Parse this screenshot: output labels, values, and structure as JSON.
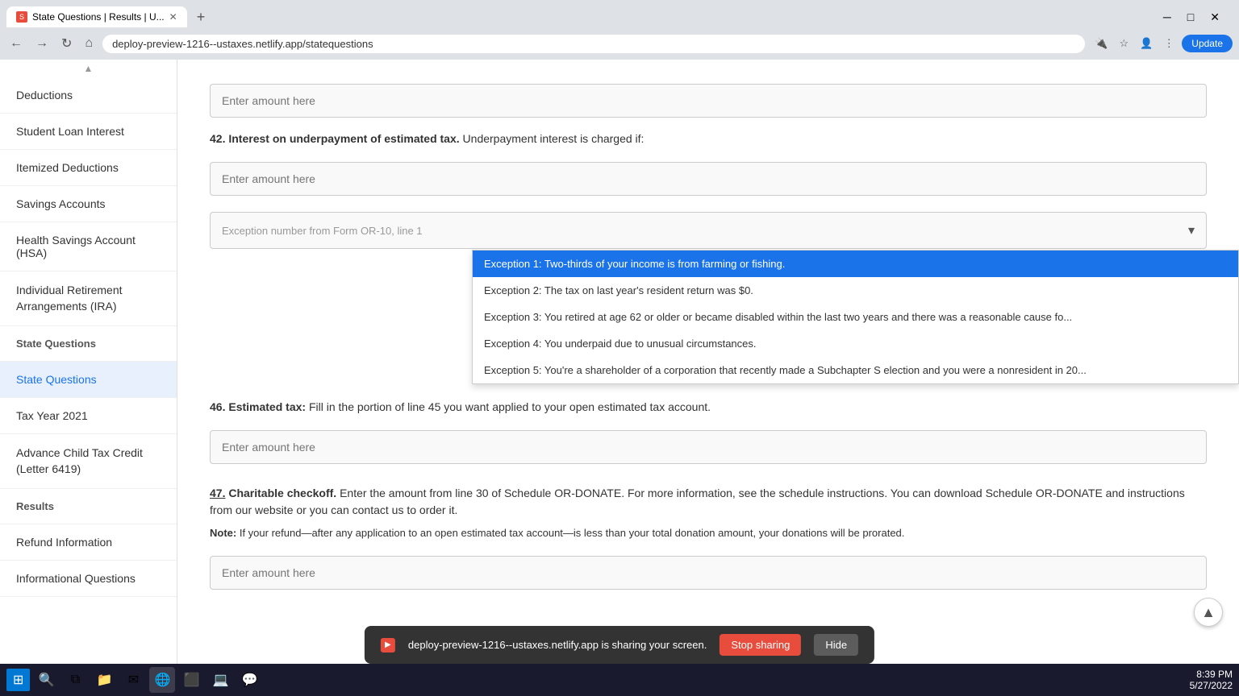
{
  "browser": {
    "tab_title": "State Questions | Results | U...",
    "tab_favicon": "S",
    "address": "deploy-preview-1216--ustaxes.netlify.app/statequestions",
    "update_btn": "Update"
  },
  "sidebar": {
    "scroll_up": "▲",
    "items": [
      {
        "id": "deductions",
        "label": "Deductions",
        "active": false
      },
      {
        "id": "student-loan",
        "label": "Student Loan Interest",
        "active": false
      },
      {
        "id": "itemized",
        "label": "Itemized Deductions",
        "active": false
      },
      {
        "id": "savings",
        "label": "Savings Accounts",
        "active": false
      },
      {
        "id": "hsa",
        "label": "Health Savings Account (HSA)",
        "active": false
      },
      {
        "id": "ira",
        "label": "Individual Retirement Arrangements (IRA)",
        "active": false
      },
      {
        "id": "state-questions-cat",
        "label": "State Questions",
        "active": false
      },
      {
        "id": "state-questions",
        "label": "State Questions",
        "active": true
      },
      {
        "id": "tax-year",
        "label": "Tax Year 2021",
        "active": false
      },
      {
        "id": "advance-child",
        "label": "Advance Child Tax Credit (Letter 6419)",
        "active": false
      },
      {
        "id": "results-cat",
        "label": "Results",
        "active": false
      },
      {
        "id": "refund",
        "label": "Refund Information",
        "active": false
      },
      {
        "id": "informational",
        "label": "Informational Questions",
        "active": false
      }
    ]
  },
  "content": {
    "top_input_placeholder": "Enter amount here",
    "q42": {
      "number": "42.",
      "title": "Interest on underpayment of estimated tax.",
      "title_suffix": " Underpayment interest is charged if:",
      "amount_placeholder": "Enter amount here",
      "dropdown_placeholder": "Exception number from Form OR-10, line 1",
      "dropdown_options": [
        {
          "label": "Exception 1: Two-thirds of your income is from farming or fishing.",
          "highlighted": true
        },
        {
          "label": "Exception 2: The tax on last year’s resident return was $0.",
          "highlighted": false
        },
        {
          "label": "Exception 3: You retired at age 62 or older or became disabled within the last two years and there was a reasonable cause fo",
          "highlighted": false
        },
        {
          "label": "Exception 4: You underpaid due to unusual circumstances.",
          "highlighted": false
        },
        {
          "label": "Exception 5: You’re a shareholder of a corporation that recently made a Subchapter S election and you were a nonresident in 20",
          "highlighted": false
        }
      ]
    },
    "q46": {
      "prefix_text": "46. Estimated tax:",
      "text": " Fill in the portion of line 45 you want applied to your open estimated tax account.",
      "amount_placeholder": "Enter amount here"
    },
    "q47": {
      "number": "47.",
      "title": "Charitable checkoff.",
      "text": " Enter the amount from line 30 of Schedule OR-DONATE. For more information, see the schedule instructions. You can download Schedule OR-DONATE and instructions from our website or you can contact us to order it.",
      "note_label": "Note:",
      "note_text": " If your refund—after any application to an open estimated tax account—is less than your total donation amount, your donations will be prorated.",
      "amount_placeholder": "Enter amount here"
    }
  },
  "screen_share_bar": {
    "icon": "▶",
    "message": "deploy-preview-1216--ustaxes.netlify.app is sharing your screen.",
    "stop_sharing": "Stop sharing",
    "hide": "Hide"
  },
  "taskbar": {
    "time": "8:39 PM",
    "date": "5/27/2022"
  }
}
